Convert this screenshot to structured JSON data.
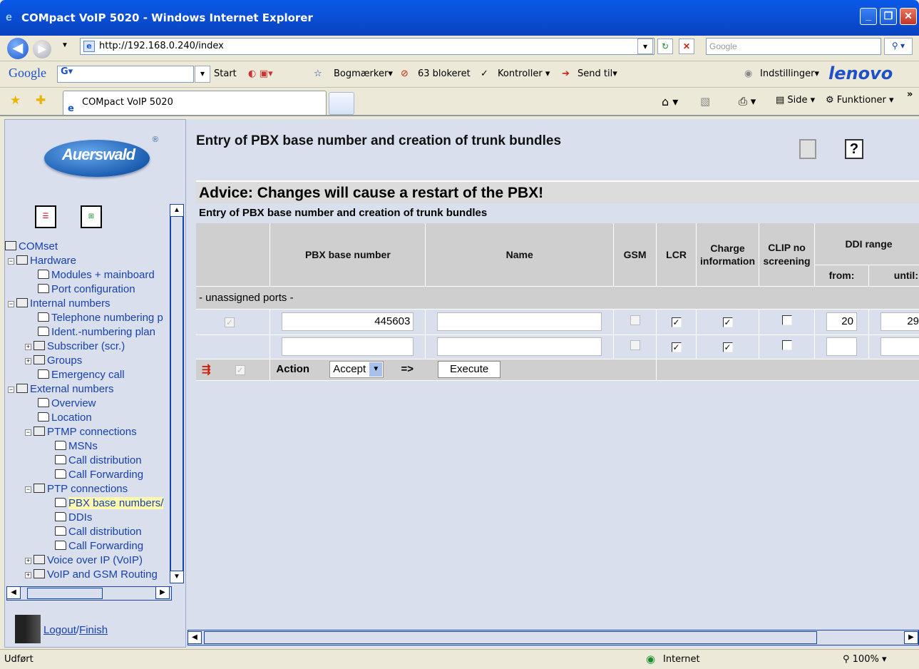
{
  "window": {
    "title": "COMpact VoIP 5020 - Windows Internet Explorer"
  },
  "address": {
    "url": "http://192.168.0.240/index",
    "search_placeholder": "Google"
  },
  "toolbar": {
    "google": "Google",
    "start": "Start",
    "bookmarks": "Bogmærker",
    "blocked": "63 blokeret",
    "check": "Kontroller",
    "send": "Send til",
    "settings": "Indstillinger",
    "brand": "lenovo"
  },
  "tabbar": {
    "tab_title": "COMpact VoIP 5020",
    "page": "Side",
    "tools": "Funktioner"
  },
  "sidebar": {
    "logo": "Auerswald",
    "tree": [
      {
        "label": "COMset"
      },
      {
        "label": "Hardware"
      },
      {
        "label": "Modules + mainboard"
      },
      {
        "label": "Port configuration"
      },
      {
        "label": "Internal numbers"
      },
      {
        "label": "Telephone numbering p"
      },
      {
        "label": "Ident.-numbering plan"
      },
      {
        "label": "Subscriber (scr.)"
      },
      {
        "label": "Groups"
      },
      {
        "label": "Emergency call"
      },
      {
        "label": "External numbers"
      },
      {
        "label": "Overview"
      },
      {
        "label": "Location"
      },
      {
        "label": "PTMP connections"
      },
      {
        "label": "MSNs"
      },
      {
        "label": "Call distribution"
      },
      {
        "label": "Call Forwarding"
      },
      {
        "label": "PTP connections"
      },
      {
        "label": "PBX base numbers/"
      },
      {
        "label": "DDIs"
      },
      {
        "label": "Call distribution"
      },
      {
        "label": "Call Forwarding"
      },
      {
        "label": "Voice over IP (VoIP)"
      },
      {
        "label": "VoIP and GSM Routing"
      }
    ],
    "logout": "Logout",
    "sep": "/",
    "finish": "Finish"
  },
  "main": {
    "heading": "Entry of PBX base number and creation of trunk bundles",
    "advice": "Advice: Changes will cause a restart of the PBX!",
    "subheading": "Entry of PBX base number and creation of trunk bundles",
    "columns": {
      "base": "PBX base number",
      "name": "Name",
      "gsm": "GSM",
      "lcr": "LCR",
      "charge": "Charge information",
      "clip": "CLIP no screening",
      "ddi": "DDI range",
      "from": "from:",
      "until": "until:"
    },
    "unassigned": "- unassigned ports -",
    "row1": {
      "base": "445603",
      "name": "",
      "from": "20",
      "until": "29"
    },
    "row2": {
      "base": "",
      "name": "",
      "from": "",
      "until": ""
    },
    "action": {
      "label": "Action",
      "select": "Accept",
      "arrow": "=>",
      "execute": "Execute"
    }
  },
  "status": {
    "left": "Udført",
    "zone": "Internet",
    "zoom": "100%"
  }
}
